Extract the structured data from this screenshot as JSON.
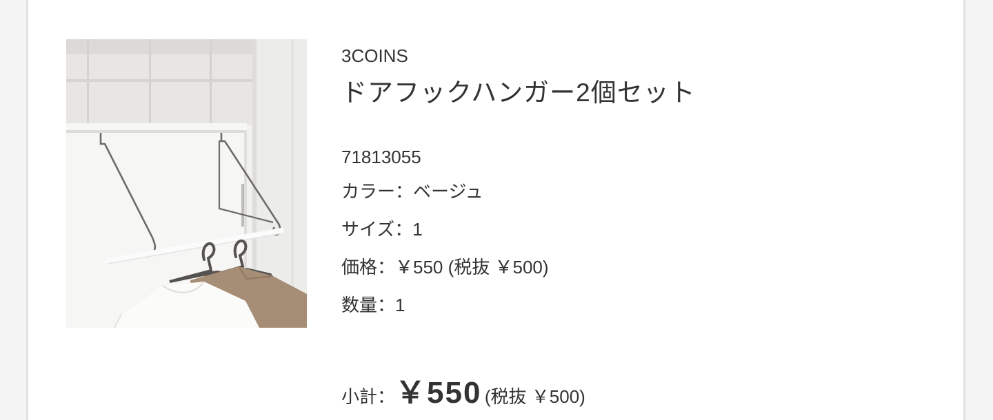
{
  "product": {
    "brand": "3COINS",
    "name": "ドアフックハンガー2個セット",
    "image_alt": "door-hook-hanger-photo",
    "sku": "71813055",
    "color_line": "カラー：ベージュ",
    "size_line": "サイズ：1",
    "price_line": "価格：￥550 (税抜 ￥500)",
    "quantity_line": "数量：1"
  },
  "subtotal": {
    "label": "小計：",
    "amount": "￥550",
    "tax_note": "(税抜 ￥500)"
  }
}
